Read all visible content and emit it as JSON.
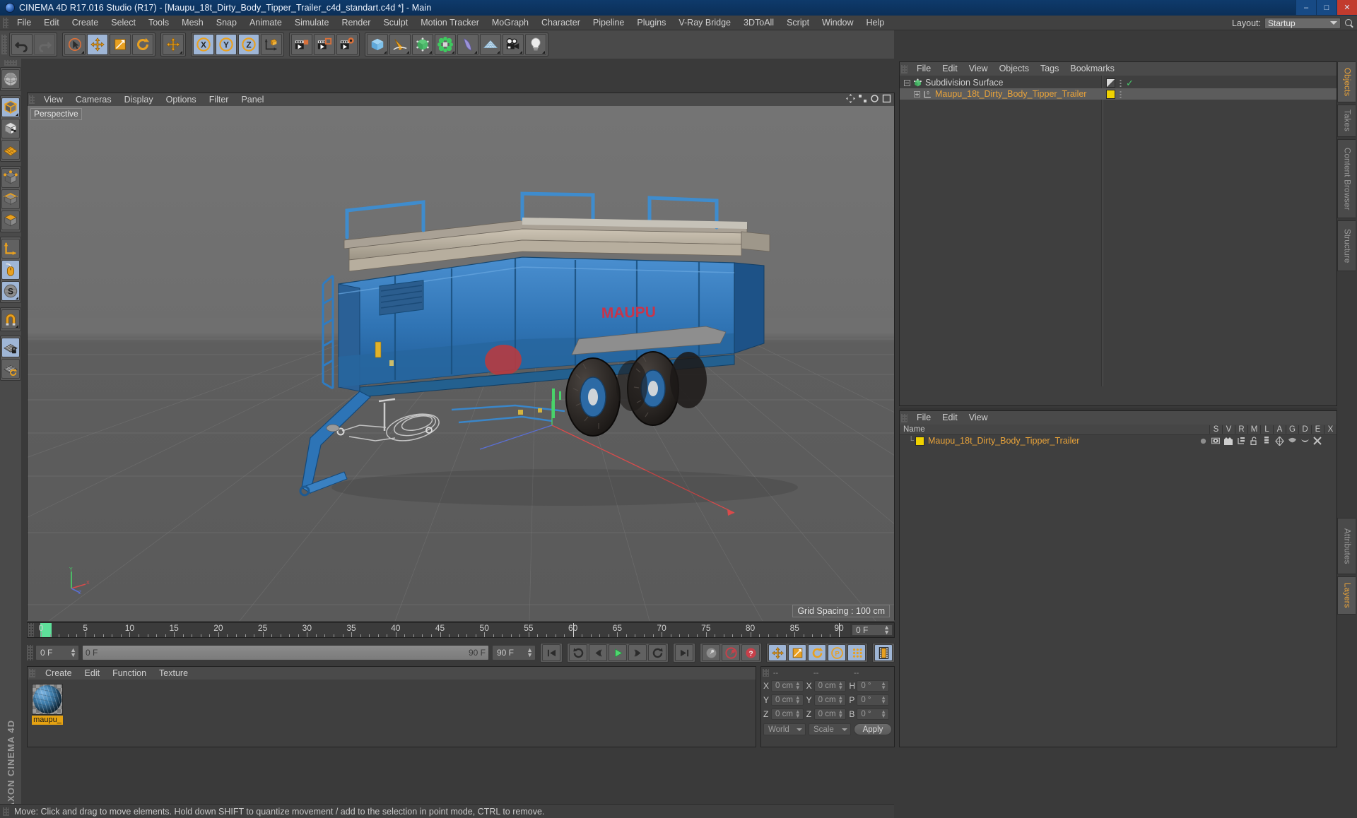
{
  "window": {
    "title": "CINEMA 4D R17.016 Studio (R17) - [Maupu_18t_Dirty_Body_Tipper_Trailer_c4d_standart.c4d *] - Main",
    "app_icon": "c4d-logo-icon",
    "minimize": "–",
    "maximize": "□",
    "close": "✕"
  },
  "menubar": {
    "items": [
      {
        "label": "File"
      },
      {
        "label": "Edit"
      },
      {
        "label": "Create"
      },
      {
        "label": "Select"
      },
      {
        "label": "Tools"
      },
      {
        "label": "Mesh"
      },
      {
        "label": "Snap"
      },
      {
        "label": "Animate"
      },
      {
        "label": "Simulate"
      },
      {
        "label": "Render"
      },
      {
        "label": "Sculpt"
      },
      {
        "label": "Motion Tracker"
      },
      {
        "label": "MoGraph"
      },
      {
        "label": "Character"
      },
      {
        "label": "Pipeline"
      },
      {
        "label": "Plugins"
      },
      {
        "label": "V-Ray Bridge"
      },
      {
        "label": "3DToAll"
      },
      {
        "label": "Script"
      },
      {
        "label": "Window"
      },
      {
        "label": "Help"
      }
    ],
    "layout_label": "Layout:",
    "layout_value": "Startup",
    "search_icon": "search-icon"
  },
  "toolbar": {
    "groups": [
      {
        "buttons": [
          {
            "name": "undo-button",
            "icon": "undo-icon",
            "active": false,
            "dim": false
          },
          {
            "name": "redo-button",
            "icon": "redo-icon",
            "active": false,
            "dim": true
          }
        ]
      },
      {
        "buttons": [
          {
            "name": "live-selection-tool",
            "icon": "cursor-circle-icon",
            "active": false,
            "dim": false,
            "corner": true
          },
          {
            "name": "move-tool",
            "icon": "move-arrows-icon",
            "active": true,
            "dim": false
          },
          {
            "name": "scale-tool",
            "icon": "scale-box-icon",
            "active": false,
            "dim": false
          },
          {
            "name": "rotate-tool",
            "icon": "rotate-icon",
            "active": false,
            "dim": false
          }
        ]
      },
      {
        "buttons": [
          {
            "name": "drag-tool",
            "icon": "move-arrows-icon",
            "active": false,
            "dim": false,
            "corner": true
          }
        ]
      },
      {
        "buttons": [
          {
            "name": "lock-x-axis",
            "icon": "axis-x-icon",
            "active": true,
            "dim": false
          },
          {
            "name": "lock-y-axis",
            "icon": "axis-y-icon",
            "active": true,
            "dim": false
          },
          {
            "name": "lock-z-axis",
            "icon": "axis-z-icon",
            "active": true,
            "dim": false
          },
          {
            "name": "world-object-coordinates",
            "icon": "world-axis-icon",
            "active": false,
            "dim": false
          }
        ]
      },
      {
        "buttons": [
          {
            "name": "render-view-button",
            "icon": "render-view-icon",
            "active": false,
            "dim": false
          },
          {
            "name": "render-region-button",
            "icon": "render-region-icon",
            "active": false,
            "dim": false
          },
          {
            "name": "render-settings-button",
            "icon": "render-settings-icon",
            "active": false,
            "dim": false
          }
        ]
      },
      {
        "buttons": [
          {
            "name": "add-cube-button",
            "icon": "cube-icon",
            "active": false,
            "dim": false,
            "corner": true
          },
          {
            "name": "add-spline-button",
            "icon": "pen-spline-icon",
            "active": false,
            "dim": false,
            "corner": true
          },
          {
            "name": "add-generator-button",
            "icon": "subdivision-icon",
            "active": false,
            "dim": false,
            "corner": true
          },
          {
            "name": "add-mograph-button",
            "icon": "mograph-cloner-icon",
            "active": false,
            "dim": false,
            "corner": true
          },
          {
            "name": "add-deformer-button",
            "icon": "bend-deformer-icon",
            "active": false,
            "dim": false,
            "corner": true
          },
          {
            "name": "add-environment-button",
            "icon": "floor-environment-icon",
            "active": false,
            "dim": false,
            "corner": true
          },
          {
            "name": "add-camera-button",
            "icon": "camera-icon",
            "active": false,
            "dim": false,
            "corner": true
          },
          {
            "name": "add-light-button",
            "icon": "light-bulb-icon",
            "active": false,
            "dim": false,
            "corner": true
          }
        ]
      }
    ]
  },
  "left_palette": {
    "groups": [
      {
        "buttons": [
          {
            "name": "make-editable-button",
            "icon": "make-editable-icon",
            "active": false
          }
        ]
      },
      {
        "buttons": [
          {
            "name": "model-mode-button",
            "icon": "model-mode-icon",
            "active": true,
            "corner": true
          },
          {
            "name": "texture-mode-button",
            "icon": "texture-mode-icon",
            "active": false
          },
          {
            "name": "workplane-mode-button",
            "icon": "workplane-icon",
            "active": false
          }
        ]
      },
      {
        "buttons": [
          {
            "name": "points-mode-button",
            "icon": "points-mode-icon",
            "active": false
          },
          {
            "name": "edges-mode-button",
            "icon": "edges-mode-icon",
            "active": false
          },
          {
            "name": "polygons-mode-button",
            "icon": "polygons-mode-icon",
            "active": false
          }
        ]
      },
      {
        "buttons": [
          {
            "name": "object-axis-mode-button",
            "icon": "axis-l-icon",
            "active": false
          },
          {
            "name": "viewport-solo-button",
            "icon": "mouse-icon",
            "active": true
          },
          {
            "name": "enable-axis-modification-button",
            "icon": "letter-s-icon",
            "active": true,
            "corner": true
          }
        ]
      },
      {
        "buttons": [
          {
            "name": "snap-magnet-button",
            "icon": "magnet-icon",
            "active": false,
            "corner": true
          }
        ]
      },
      {
        "buttons": [
          {
            "name": "lock-workplane-button",
            "icon": "workplane-lock-icon",
            "active": true
          },
          {
            "name": "planar-workplane-button",
            "icon": "workplane-rotate-icon",
            "active": false
          }
        ]
      }
    ],
    "brand": "MAXON CINEMA 4D"
  },
  "viewport": {
    "menu": [
      {
        "label": "View"
      },
      {
        "label": "Cameras"
      },
      {
        "label": "Display"
      },
      {
        "label": "Options"
      },
      {
        "label": "Filter"
      },
      {
        "label": "Panel"
      }
    ],
    "camera_label": "Perspective",
    "grid_spacing": "Grid Spacing : 100 cm",
    "corner_icons": [
      "move-view-icon",
      "scale-view-icon",
      "rotate-view-icon",
      "maximize-view-icon"
    ],
    "axis_labels": {
      "x": "X",
      "y": "Y",
      "z": "Z"
    },
    "scene_object": "Maupu 18t Dirty Body Tipper Trailer"
  },
  "timeline": {
    "ticks": [
      {
        "label": "0",
        "value": 0
      },
      {
        "label": "5",
        "value": 5
      },
      {
        "label": "10",
        "value": 10
      },
      {
        "label": "15",
        "value": 15
      },
      {
        "label": "20",
        "value": 20
      },
      {
        "label": "25",
        "value": 25
      },
      {
        "label": "30",
        "value": 30
      },
      {
        "label": "35",
        "value": 35
      },
      {
        "label": "40",
        "value": 40
      },
      {
        "label": "45",
        "value": 45
      },
      {
        "label": "50",
        "value": 50
      },
      {
        "label": "55",
        "value": 55
      },
      {
        "label": "60",
        "value": 60
      },
      {
        "label": "65",
        "value": 65
      },
      {
        "label": "70",
        "value": 70
      },
      {
        "label": "75",
        "value": 75
      },
      {
        "label": "80",
        "value": 80
      },
      {
        "label": "85",
        "value": 85
      },
      {
        "label": "90",
        "value": 90
      }
    ],
    "range_start": 0,
    "range_end": 90,
    "current_frame_field": "0 F",
    "playhead_frame": 0
  },
  "playback": {
    "current_frame": "0 F",
    "range_start_label": "0 F",
    "range_end_label": "90 F",
    "end_field": "90 F",
    "buttons": [
      {
        "name": "go-to-start-button",
        "icon": "skip-start-icon",
        "active": false
      },
      {
        "name": "play-backwards-button",
        "icon": "rewind-loop-icon",
        "active": false
      },
      {
        "name": "previous-frame-button",
        "icon": "step-back-icon",
        "active": false
      },
      {
        "name": "play-button",
        "icon": "play-icon",
        "active": false
      },
      {
        "name": "next-frame-button",
        "icon": "step-forward-icon",
        "active": false
      },
      {
        "name": "play-forwards-button",
        "icon": "forward-loop-icon",
        "active": false
      },
      {
        "name": "go-to-end-button",
        "icon": "skip-end-icon",
        "active": false
      },
      {
        "name": "record-active-objects-button",
        "icon": "key-record-icon",
        "active": false
      },
      {
        "name": "autokeying-button",
        "icon": "autokey-icon",
        "active": false
      },
      {
        "name": "keying-help-button",
        "icon": "question-icon",
        "active": false
      },
      {
        "name": "record-position-button",
        "icon": "position-key-icon",
        "active": true
      },
      {
        "name": "record-scale-button",
        "icon": "scale-key-icon",
        "active": true
      },
      {
        "name": "record-rotation-button",
        "icon": "rotation-key-icon",
        "active": true
      },
      {
        "name": "record-pla-button",
        "icon": "pla-key-icon",
        "active": true
      },
      {
        "name": "record-parameter-button",
        "icon": "param-key-icon",
        "active": true
      },
      {
        "name": "timeline-toggle-button",
        "icon": "filmstrip-icon",
        "active": true
      }
    ]
  },
  "material_manager": {
    "menu": [
      {
        "label": "Create"
      },
      {
        "label": "Edit"
      },
      {
        "label": "Function"
      },
      {
        "label": "Texture"
      }
    ],
    "materials": [
      {
        "name": "maupu_",
        "preview": "blue-dirty-sphere"
      }
    ]
  },
  "coordinates": {
    "headers": [
      "--",
      "--",
      "--"
    ],
    "rows": [
      {
        "axis1": "X",
        "value1": "0 cm",
        "axis2": "X",
        "value2": "0 cm",
        "axis3": "H",
        "value3": "0 °"
      },
      {
        "axis1": "Y",
        "value1": "0 cm",
        "axis2": "Y",
        "value2": "0 cm",
        "axis3": "P",
        "value3": "0 °"
      },
      {
        "axis1": "Z",
        "value1": "0 cm",
        "axis2": "Z",
        "value2": "0 cm",
        "axis3": "B",
        "value3": "0 °"
      }
    ],
    "system": "World",
    "mode": "Scale",
    "apply_label": "Apply"
  },
  "object_manager": {
    "menu": [
      {
        "label": "File"
      },
      {
        "label": "Edit"
      },
      {
        "label": "View"
      },
      {
        "label": "Objects"
      },
      {
        "label": "Tags"
      },
      {
        "label": "Bookmarks"
      }
    ],
    "rows": [
      {
        "name": "Subdivision Surface",
        "indent": 0,
        "expander": "minus",
        "icon": "subdivision-surface-icon",
        "selected": false,
        "tags": [
          "visibility-dots-icon",
          "check-icon"
        ]
      },
      {
        "name": "Maupu_18t_Dirty_Body_Tipper_Trailer",
        "indent": 1,
        "expander": "plus",
        "icon": "null-layer-icon",
        "selected": true,
        "tags": [
          "yellow-layer-swatch",
          "visibility-dots-icon"
        ]
      }
    ]
  },
  "layer_manager": {
    "menu": [
      {
        "label": "File"
      },
      {
        "label": "Edit"
      },
      {
        "label": "View"
      }
    ],
    "columns": [
      "Name",
      "S",
      "V",
      "R",
      "M",
      "L",
      "A",
      "G",
      "D",
      "E",
      "X"
    ],
    "rows": [
      {
        "name": "Maupu_18t_Dirty_Body_Tipper_Trailer",
        "color": "#f0d200",
        "cells": [
          "solo-dot-icon",
          "visible-eye-icon",
          "render-clapper-icon",
          "manager-tree-icon",
          "unlocked-padlock-icon",
          "animation-bars-icon",
          "generator-icon",
          "deformer-icon",
          "expression-icon",
          "xpresso-icon"
        ]
      }
    ]
  },
  "right_tabs": {
    "top": [
      {
        "label": "Objects",
        "active": true
      },
      {
        "label": "Takes",
        "active": false
      },
      {
        "label": "Content Browser",
        "active": false
      },
      {
        "label": "Structure",
        "active": false
      }
    ],
    "bottom": [
      {
        "label": "Attributes",
        "active": false
      },
      {
        "label": "Layers",
        "active": true
      }
    ]
  },
  "statusbar": {
    "text": "Move: Click and drag to move elements. Hold down SHIFT to quantize movement / add to the selection in point mode, CTRL to remove."
  },
  "colors": {
    "accent_orange": "#e9a33a",
    "layer_yellow": "#f0d200",
    "title_blue": "#0e3a6b",
    "panel_bg": "#3f3f3f",
    "toolbar_bg": "#4a4a4a",
    "active_blue": "#9fb6d6",
    "playhead_green": "#5ee09a",
    "trailer_blue": "#2d6fb5"
  }
}
